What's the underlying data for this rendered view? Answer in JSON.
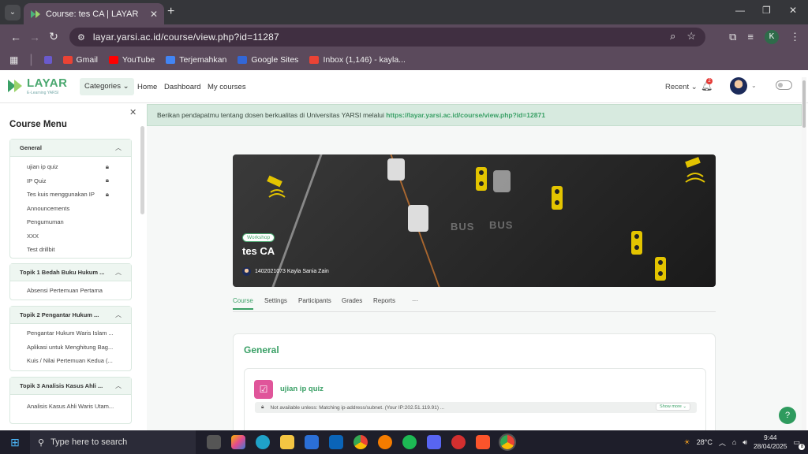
{
  "browser": {
    "tab_title": "Course: tes CA | LAYAR",
    "url": "layar.yarsi.ac.id/course/view.php?id=11287",
    "profile_initial": "K",
    "bookmarks": [
      "Gmail",
      "YouTube",
      "Terjemahkan",
      "Google Sites",
      "Inbox (1,146) - kayla..."
    ]
  },
  "header": {
    "logo_text": "LAYAR",
    "logo_sub": "E-Learning YARSI",
    "categories": "Categories",
    "nav": [
      "Home",
      "Dashboard",
      "My courses"
    ],
    "recent": "Recent",
    "notif_count": "2"
  },
  "sidebar": {
    "title": "Course Menu",
    "sections": [
      {
        "title": "General",
        "items": [
          {
            "label": "ujian ip quiz",
            "locked": true
          },
          {
            "label": "IP Quiz",
            "locked": true
          },
          {
            "label": "Tes kuis menggunakan IP",
            "locked": true
          },
          {
            "label": "Announcements",
            "locked": false
          },
          {
            "label": "Pengumuman",
            "locked": false
          },
          {
            "label": "XXX",
            "locked": false
          },
          {
            "label": "Test drillbit",
            "locked": false
          }
        ]
      },
      {
        "title": "Topik 1 Bedah Buku Hukum ...",
        "items": [
          {
            "label": "Absensi Pertemuan Pertama",
            "locked": false
          }
        ]
      },
      {
        "title": "Topik 2 Pengantar Hukum ...",
        "items": [
          {
            "label": "Pengantar Hukum Waris Islam ...",
            "locked": false
          },
          {
            "label": "Aplikasi untuk Menghitung Bag...",
            "locked": false
          },
          {
            "label": "Kuis / Nilai Pertemuan Kedua (...",
            "locked": false
          }
        ]
      },
      {
        "title": "Topik 3 Analisis Kasus Ahli ...",
        "items": [
          {
            "label": "Analisis Kasus Ahli Waris Utam...",
            "locked": false
          }
        ]
      }
    ]
  },
  "main": {
    "banner_text": "Berikan pendapatmu tentang dosen berkualitas di Universitas YARSI melalui ",
    "banner_link": "https://layar.yarsi.ac.id/course/view.php?id=12871",
    "hero": {
      "badge": "Workshop",
      "title": "tes CA",
      "author": "1402021073 Kayla Sania Zain",
      "road_text": [
        "BUS",
        "BUS"
      ]
    },
    "tabs": [
      "Course",
      "Settings",
      "Participants",
      "Grades",
      "Reports",
      "···"
    ],
    "general_title": "General",
    "activity": {
      "title": "ujian ip quiz",
      "restriction": "Not available unless: Matching ip-address/subnet. (Your IP:202.51.119.91) ...",
      "show_more": "Show more"
    }
  },
  "taskbar": {
    "search_placeholder": "Type here to search",
    "temperature": "28°C",
    "time": "9:44",
    "date": "28/04/2025",
    "notification_count": "8"
  }
}
